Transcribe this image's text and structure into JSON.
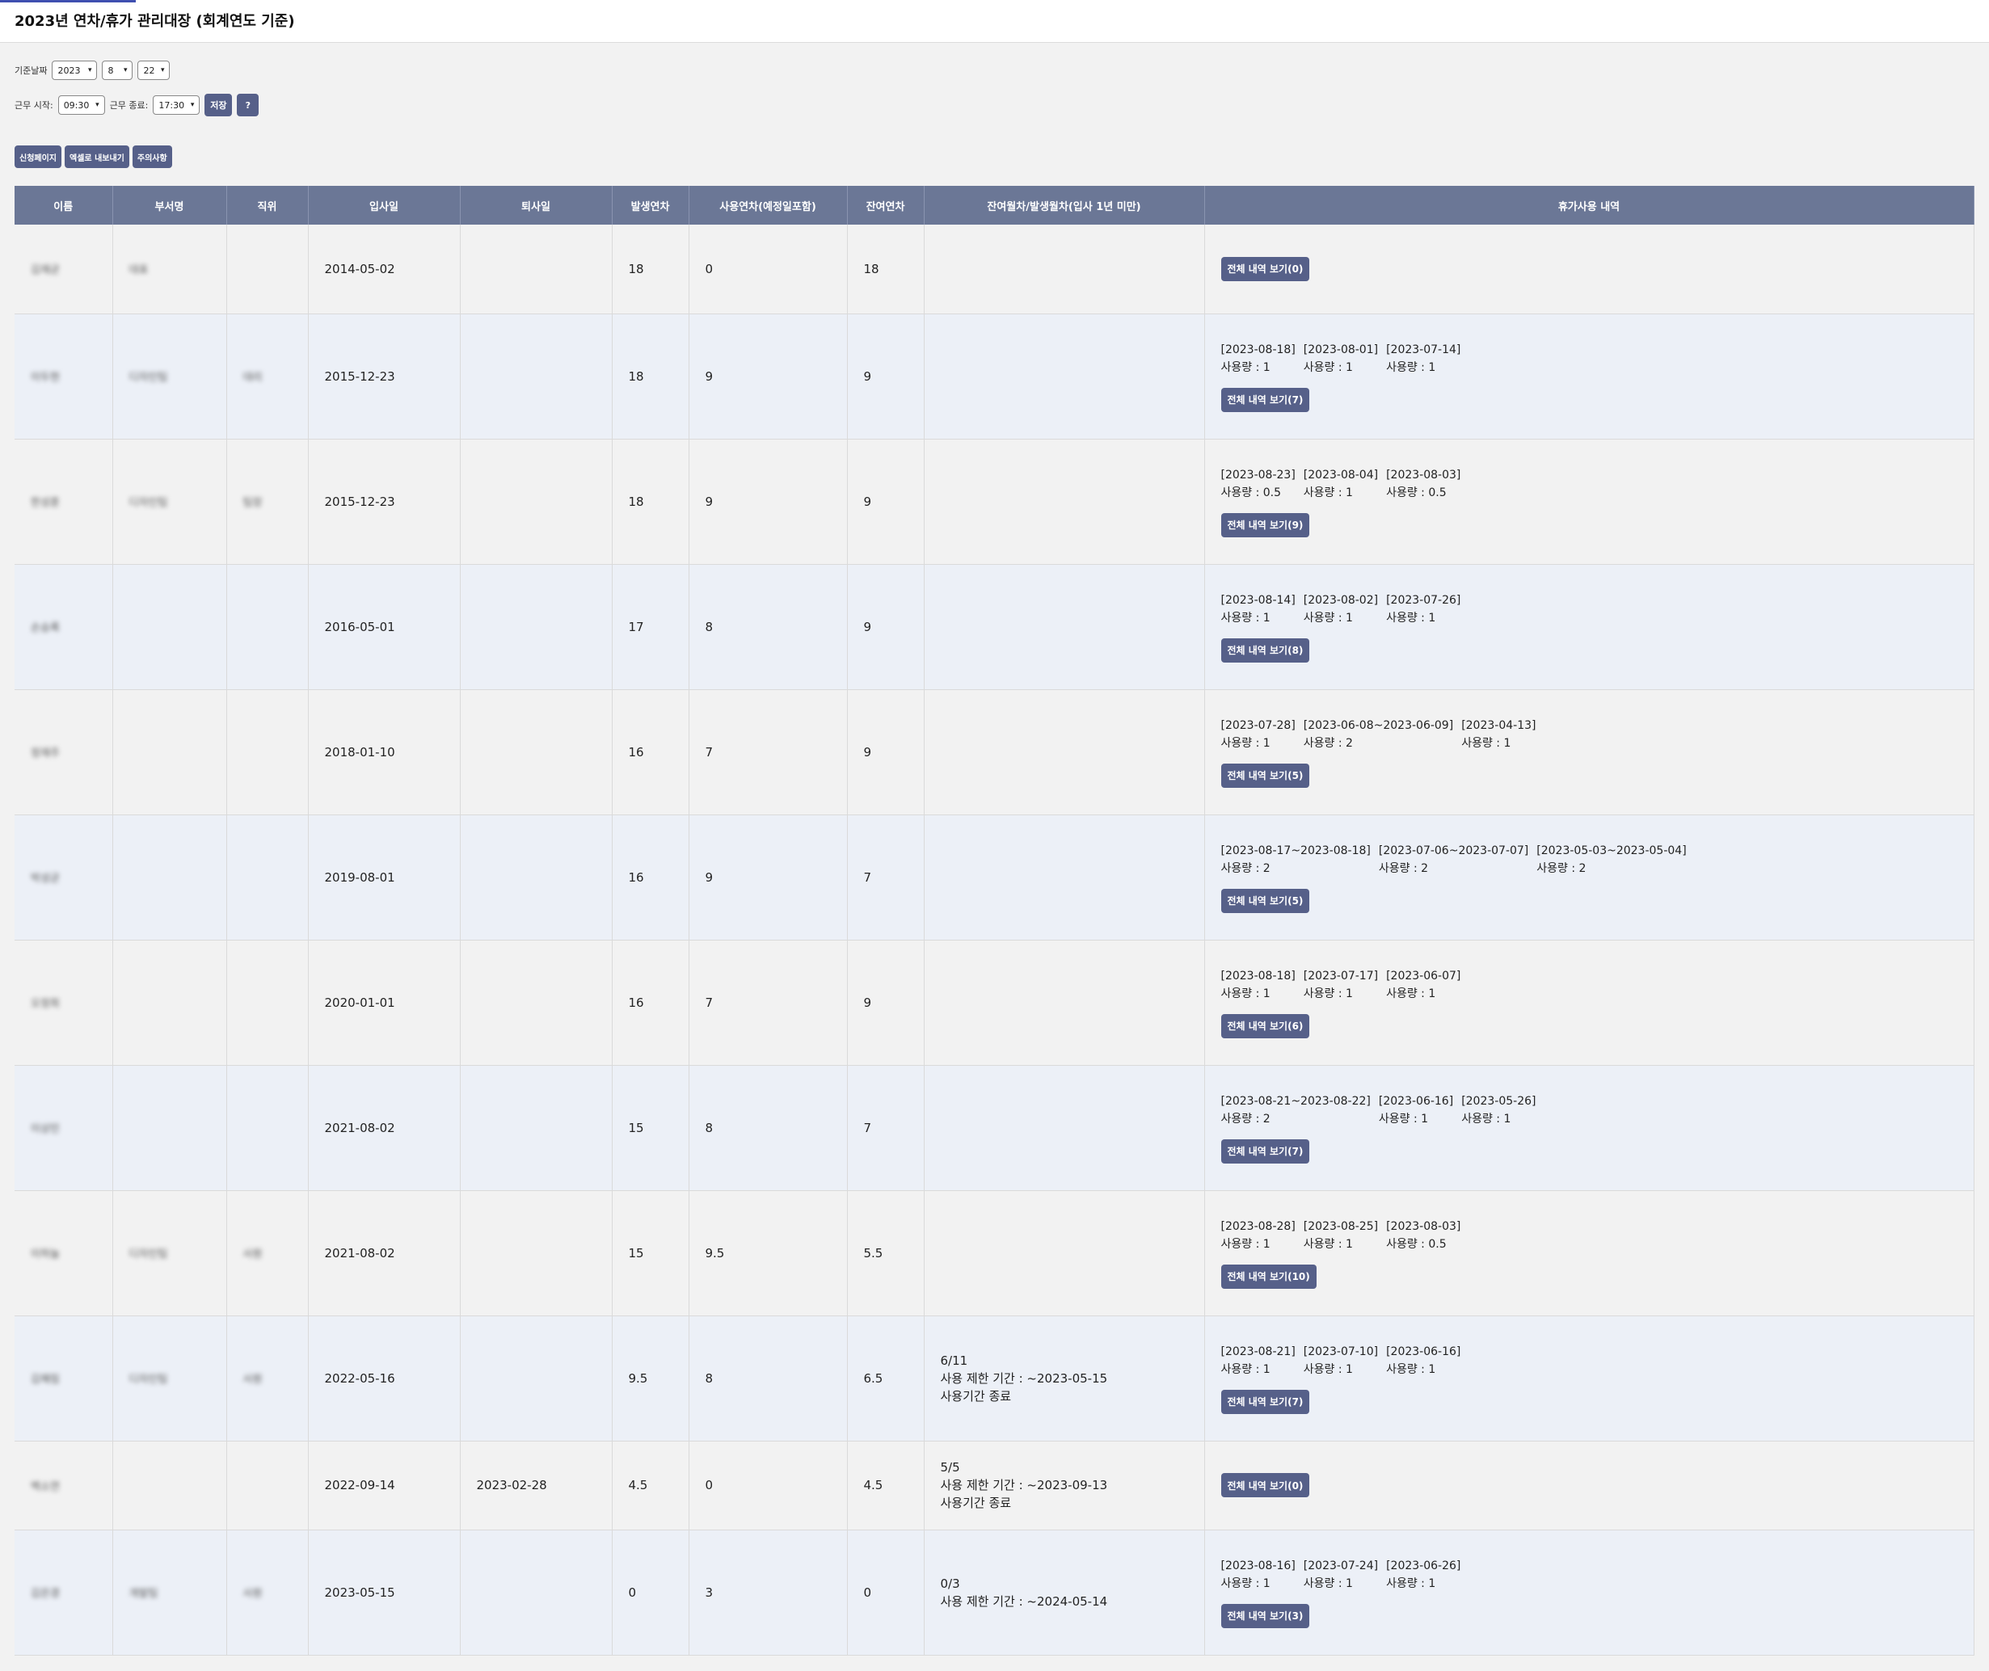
{
  "title": "2023년 연차/휴가 관리대장 (회계연도 기준)",
  "controls": {
    "date_label": "기준날짜",
    "year": "2023",
    "month": "8",
    "day": "22",
    "work_start_label": "근무 시작:",
    "work_start": "09:30",
    "work_end_label": "근무 종료:",
    "work_end": "17:30",
    "save_label": "저장",
    "help_label": "?"
  },
  "actions": {
    "apply_page": "신청페이지",
    "export_excel": "엑셀로 내보내기",
    "notice": "주의사항"
  },
  "columns": [
    "이름",
    "부서명",
    "직위",
    "입사일",
    "퇴사일",
    "발생연차",
    "사용연차(예정일포함)",
    "잔여연차",
    "잔여월차/발생월차(입사 1년 미만)",
    "휴가사용 내역"
  ],
  "usage_prefix": "사용량 : ",
  "rows": [
    {
      "name": "김재균",
      "dept": "대표",
      "position": "",
      "hire": "2014-05-02",
      "leave": "",
      "gen": "18",
      "used": "0",
      "remain": "18",
      "monthly": [],
      "entries": [],
      "btn": "전체 내역 보기(0)"
    },
    {
      "name": "이두현",
      "dept": "디자인팀",
      "position": "대리",
      "hire": "2015-12-23",
      "leave": "",
      "gen": "18",
      "used": "9",
      "remain": "9",
      "monthly": [],
      "entries": [
        {
          "date": "[2023-08-18]",
          "use": "사용량 : 1"
        },
        {
          "date": "[2023-08-01]",
          "use": "사용량 : 1"
        },
        {
          "date": "[2023-07-14]",
          "use": "사용량 : 1"
        }
      ],
      "btn": "전체 내역 보기(7)"
    },
    {
      "name": "한성훈",
      "dept": "디자인팀",
      "position": "팀장",
      "hire": "2015-12-23",
      "leave": "",
      "gen": "18",
      "used": "9",
      "remain": "9",
      "monthly": [],
      "entries": [
        {
          "date": "[2023-08-23]",
          "use": "사용량 : 0.5"
        },
        {
          "date": "[2023-08-04]",
          "use": "사용량 : 1"
        },
        {
          "date": "[2023-08-03]",
          "use": "사용량 : 0.5"
        }
      ],
      "btn": "전체 내역 보기(9)"
    },
    {
      "name": "손승록",
      "dept": "",
      "position": "",
      "hire": "2016-05-01",
      "leave": "",
      "gen": "17",
      "used": "8",
      "remain": "9",
      "monthly": [],
      "entries": [
        {
          "date": "[2023-08-14]",
          "use": "사용량 : 1"
        },
        {
          "date": "[2023-08-02]",
          "use": "사용량 : 1"
        },
        {
          "date": "[2023-07-26]",
          "use": "사용량 : 1"
        }
      ],
      "btn": "전체 내역 보기(8)"
    },
    {
      "name": "정재주",
      "dept": "",
      "position": "",
      "hire": "2018-01-10",
      "leave": "",
      "gen": "16",
      "used": "7",
      "remain": "9",
      "monthly": [],
      "entries": [
        {
          "date": "[2023-07-28]",
          "use": "사용량 : 1"
        },
        {
          "date": "[2023-06-08~2023-06-09]",
          "use": "사용량 : 2"
        },
        {
          "date": "[2023-04-13]",
          "use": "사용량 : 1"
        }
      ],
      "btn": "전체 내역 보기(5)"
    },
    {
      "name": "박성균",
      "dept": "",
      "position": "",
      "hire": "2019-08-01",
      "leave": "",
      "gen": "16",
      "used": "9",
      "remain": "7",
      "monthly": [],
      "entries": [
        {
          "date": "[2023-08-17~2023-08-18]",
          "use": "사용량 : 2"
        },
        {
          "date": "[2023-07-06~2023-07-07]",
          "use": "사용량 : 2"
        },
        {
          "date": "[2023-05-03~2023-05-04]",
          "use": "사용량 : 2"
        }
      ],
      "btn": "전체 내역 보기(5)"
    },
    {
      "name": "오정희",
      "dept": "",
      "position": "",
      "hire": "2020-01-01",
      "leave": "",
      "gen": "16",
      "used": "7",
      "remain": "9",
      "monthly": [],
      "entries": [
        {
          "date": "[2023-08-18]",
          "use": "사용량 : 1"
        },
        {
          "date": "[2023-07-17]",
          "use": "사용량 : 1"
        },
        {
          "date": "[2023-06-07]",
          "use": "사용량 : 1"
        }
      ],
      "btn": "전체 내역 보기(6)"
    },
    {
      "name": "이상민",
      "dept": "",
      "position": "",
      "hire": "2021-08-02",
      "leave": "",
      "gen": "15",
      "used": "8",
      "remain": "7",
      "monthly": [],
      "entries": [
        {
          "date": "[2023-08-21~2023-08-22]",
          "use": "사용량 : 2"
        },
        {
          "date": "[2023-06-16]",
          "use": "사용량 : 1"
        },
        {
          "date": "[2023-05-26]",
          "use": "사용량 : 1"
        }
      ],
      "btn": "전체 내역 보기(7)"
    },
    {
      "name": "이하늘",
      "dept": "디자인팀",
      "position": "사원",
      "hire": "2021-08-02",
      "leave": "",
      "gen": "15",
      "used": "9.5",
      "remain": "5.5",
      "monthly": [],
      "entries": [
        {
          "date": "[2023-08-28]",
          "use": "사용량 : 1"
        },
        {
          "date": "[2023-08-25]",
          "use": "사용량 : 1"
        },
        {
          "date": "[2023-08-03]",
          "use": "사용량 : 0.5"
        }
      ],
      "btn": "전체 내역 보기(10)"
    },
    {
      "name": "김혜림",
      "dept": "디자인팀",
      "position": "사원",
      "hire": "2022-05-16",
      "leave": "",
      "gen": "9.5",
      "used": "8",
      "remain": "6.5",
      "monthly": [
        "6/11",
        "사용 제한 기간 : ~2023-05-15",
        "사용기간 종료"
      ],
      "entries": [
        {
          "date": "[2023-08-21]",
          "use": "사용량 : 1"
        },
        {
          "date": "[2023-07-10]",
          "use": "사용량 : 1"
        },
        {
          "date": "[2023-06-16]",
          "use": "사용량 : 1"
        }
      ],
      "btn": "전체 내역 보기(7)"
    },
    {
      "name": "백소연",
      "dept": "",
      "position": "",
      "hire": "2022-09-14",
      "leave": "2023-02-28",
      "gen": "4.5",
      "used": "0",
      "remain": "4.5",
      "monthly": [
        "5/5",
        "사용 제한 기간 : ~2023-09-13",
        "사용기간 종료"
      ],
      "entries": [],
      "btn": "전체 내역 보기(0)"
    },
    {
      "name": "김은경",
      "dept": "개발팀",
      "position": "사원",
      "hire": "2023-05-15",
      "leave": "",
      "gen": "0",
      "used": "3",
      "remain": "0",
      "monthly": [
        "0/3",
        "사용 제한 기간 : ~2024-05-14"
      ],
      "entries": [
        {
          "date": "[2023-08-16]",
          "use": "사용량 : 1"
        },
        {
          "date": "[2023-07-24]",
          "use": "사용량 : 1"
        },
        {
          "date": "[2023-06-26]",
          "use": "사용량 : 1"
        }
      ],
      "btn": "전체 내역 보기(3)"
    }
  ]
}
